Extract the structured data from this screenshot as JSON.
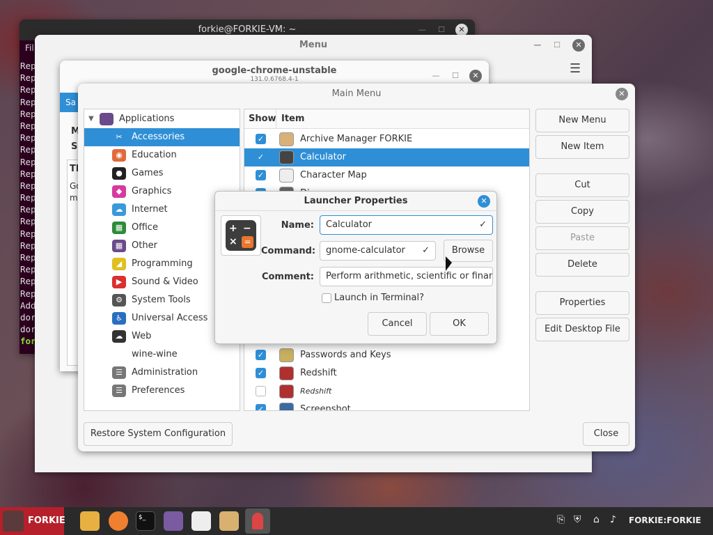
{
  "terminal": {
    "title": "forkie@FORKIE-VM: ~",
    "menu_stub": "Fil",
    "lines": [
      "Rep",
      "Rep",
      "Rep",
      "Rep",
      "Rep",
      "Rep",
      "Rep",
      "Rep",
      "Rep",
      "Rep",
      "Rep",
      "Rep",
      "Rep",
      "Rep",
      "Rep",
      "Rep",
      "Rep",
      "Rep",
      "Rep",
      "Rep",
      "Add",
      "dor",
      "dor",
      "for"
    ]
  },
  "menu_window": {
    "title": "Menu"
  },
  "chrome_dialog": {
    "title": "google-chrome-unstable",
    "subtitle": "131.0.6768.4-1",
    "tab_stub": "Sa",
    "label_m": "M",
    "label_si": "Si",
    "label_th": "Th",
    "label_go": "Go",
    "label_m2": "m"
  },
  "main_menu": {
    "title": "Main Menu",
    "tree": {
      "root": "Applications",
      "items": [
        {
          "label": "Accessories",
          "color": "#2f8fd6",
          "glyph": "✂"
        },
        {
          "label": "Education",
          "color": "#e06a3c",
          "glyph": "◉"
        },
        {
          "label": "Games",
          "color": "#222222",
          "glyph": "●"
        },
        {
          "label": "Graphics",
          "color": "#d63aa0",
          "glyph": "◆"
        },
        {
          "label": "Internet",
          "color": "#3a9ad9",
          "glyph": "☁"
        },
        {
          "label": "Office",
          "color": "#2e8b3a",
          "glyph": "▦"
        },
        {
          "label": "Other",
          "color": "#6a4a8a",
          "glyph": "▦"
        },
        {
          "label": "Programming",
          "color": "#e0c020",
          "glyph": "◢"
        },
        {
          "label": "Sound & Video",
          "color": "#d93030",
          "glyph": "▶"
        },
        {
          "label": "System Tools",
          "color": "#555555",
          "glyph": "⚙"
        },
        {
          "label": "Universal Access",
          "color": "#2a6ec0",
          "glyph": "♿"
        },
        {
          "label": "Web",
          "color": "#333333",
          "glyph": "☁"
        },
        {
          "label": "wine-wine",
          "color": "",
          "glyph": ""
        },
        {
          "label": "Administration",
          "color": "#777777",
          "glyph": "☰"
        },
        {
          "label": "Preferences",
          "color": "#777777",
          "glyph": "☰"
        }
      ]
    },
    "columns": {
      "show": "Show",
      "item": "Item"
    },
    "items": [
      {
        "label": "Archive Manager FORKIE",
        "checked": true,
        "color": "#d9b07a"
      },
      {
        "label": "Calculator",
        "checked": true,
        "color": "#444444"
      },
      {
        "label": "Character Map",
        "checked": true,
        "color": "#eeeeee"
      },
      {
        "label": "Di",
        "checked": true,
        "color": "#666666"
      },
      {
        "label": "Passwords and Keys",
        "checked": true,
        "color": "#c8b060"
      },
      {
        "label": "Redshift",
        "checked": true,
        "color": "#b03030"
      },
      {
        "label": "Redshift",
        "checked": false,
        "color": "#b03030"
      },
      {
        "label": "Screenshot",
        "checked": true,
        "color": "#3a6aa0"
      }
    ],
    "buttons": {
      "new_menu": "New Menu",
      "new_item": "New Item",
      "cut": "Cut",
      "copy": "Copy",
      "paste": "Paste",
      "delete": "Delete",
      "properties": "Properties",
      "edit_desktop": "Edit Desktop File",
      "restore": "Restore System Configuration",
      "close": "Close"
    }
  },
  "launcher": {
    "title": "Launcher Properties",
    "name_label": "Name:",
    "name_value": "Calculator",
    "command_label": "Command:",
    "command_value": "gnome-calculator",
    "browse": "Browse",
    "comment_label": "Comment:",
    "comment_value": "Perform arithmetic, scientific or financi",
    "terminal_label": "Launch in Terminal?",
    "cancel": "Cancel",
    "ok": "OK"
  },
  "taskbar": {
    "start_label": "FORKIE",
    "user": "FORKIE:FORKIE"
  }
}
